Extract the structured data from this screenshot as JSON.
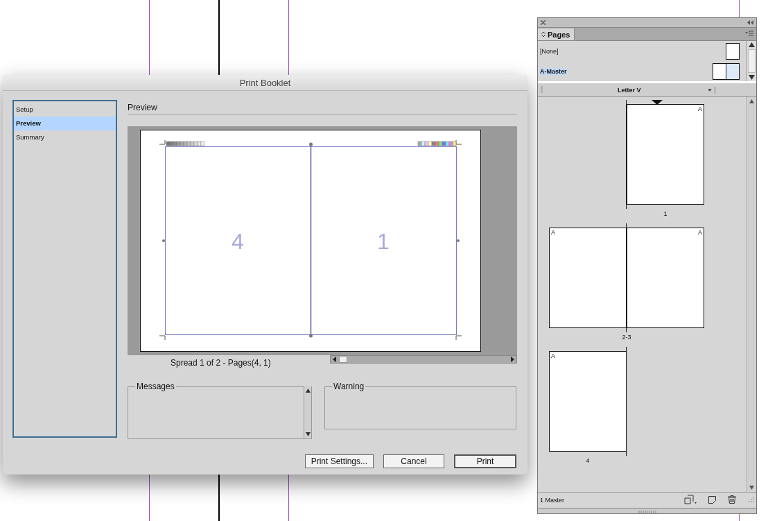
{
  "dialog": {
    "title": "Print Booklet",
    "nav": [
      {
        "label": "Setup",
        "selected": false
      },
      {
        "label": "Preview",
        "selected": true
      },
      {
        "label": "Summary",
        "selected": false
      }
    ],
    "section_title": "Preview",
    "preview_pages": [
      "4",
      "1"
    ],
    "spread_caption": "Spread 1 of 2 - Pages(4, 1)",
    "messages_label": "Messages",
    "warning_label": "Warning",
    "buttons": [
      {
        "label": "Print Settings...",
        "default": false
      },
      {
        "label": "Cancel",
        "default": false
      },
      {
        "label": "Print",
        "default": true
      }
    ]
  },
  "pages_panel": {
    "tab": "Pages",
    "masters": [
      {
        "label": "[None]",
        "selected": false,
        "kind": "single"
      },
      {
        "label": "A-Master",
        "selected": true,
        "kind": "spread"
      }
    ],
    "page_size": "Letter V",
    "spreads": [
      {
        "label": "1",
        "current": true,
        "right_page": {
          "master": "A"
        }
      },
      {
        "label": "2-3",
        "current": false,
        "left_page": {
          "master": "A"
        },
        "right_page": {
          "master": "A"
        }
      },
      {
        "label": "4",
        "current": false,
        "left_page": {
          "master": "A"
        }
      }
    ],
    "status": "1 Master"
  }
}
